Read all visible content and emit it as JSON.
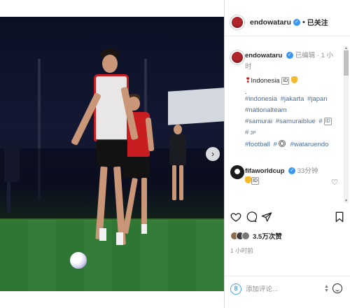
{
  "post": {
    "author": "endowataru",
    "follow_label": "已关注",
    "caption_meta": "已编辑 · 1 小时",
    "caption_location": "Indonesia",
    "caption_flag": "ID",
    "hashtags": [
      "#indonesia",
      "#jakarta",
      "#japan",
      "#nationalteam",
      "#samurai",
      "#samuraiblue",
      "#",
      "#football",
      "#wataruendo"
    ],
    "comment": {
      "author": "fifaworldcup",
      "time": "33分钟",
      "flag": "ID"
    },
    "likes_label": "3.5万次赞",
    "time_ago": "1 小时前",
    "add_comment_placeholder": "添加评论...",
    "accent_color": "#3897f0"
  }
}
